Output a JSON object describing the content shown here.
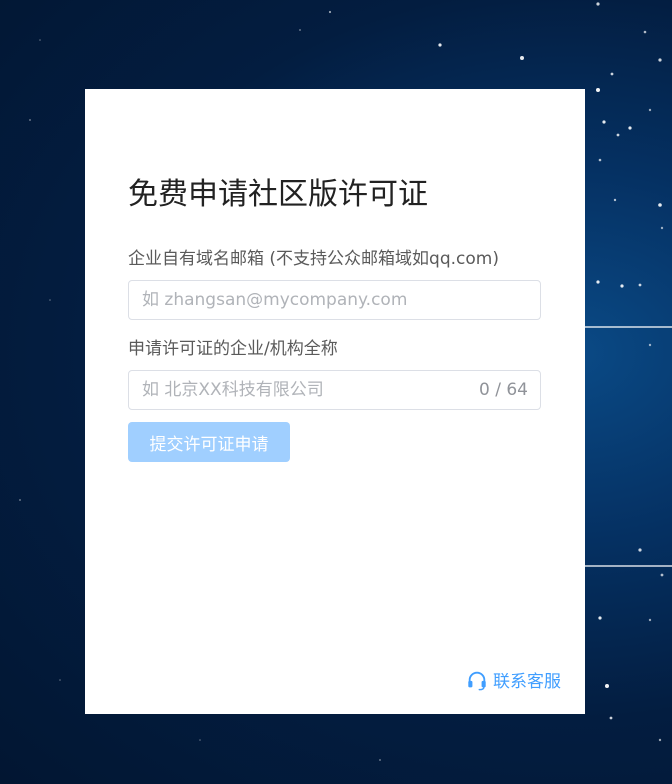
{
  "form": {
    "title": "免费申请社区版许可证",
    "email_label": "企业自有域名邮箱 (不支持公众邮箱域如qq.com)",
    "email_value": "",
    "email_placeholder": "如 zhangsan@mycompany.com",
    "org_label": "申请许可证的企业/机构全称",
    "org_value": "",
    "org_placeholder": "如 北京XX科技有限公司",
    "org_counter": "0 / 64",
    "submit_label": "提交许可证申请",
    "support_label": "联系客服"
  },
  "colors": {
    "primary": "#409eff",
    "button_disabled": "#a0cfff",
    "background_dark": "#021632"
  },
  "icons": {
    "support": "headset-icon"
  }
}
